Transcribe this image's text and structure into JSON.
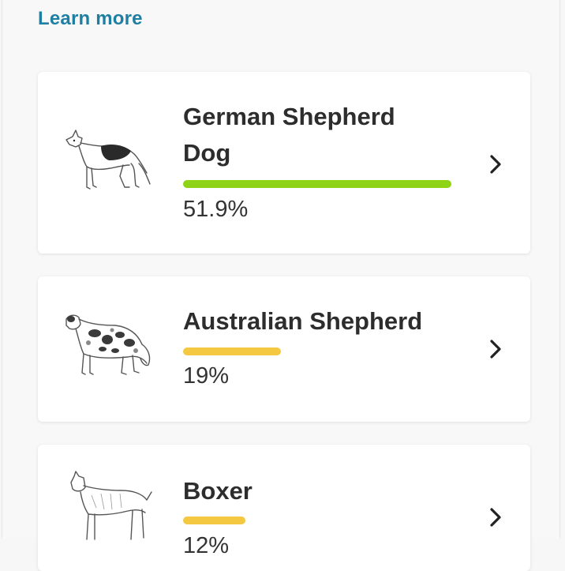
{
  "learn_more": "Learn more",
  "colors": {
    "link": "#1f7fa3",
    "bar_high": "#8fd316",
    "bar_low": "#f5c842"
  },
  "breeds": [
    {
      "name": "German Shepherd Dog",
      "percent_label": "51.9%",
      "percent": 51.9,
      "bar_color": "#8fd316",
      "icon": "german-shepherd-illustration"
    },
    {
      "name": "Australian Shepherd",
      "percent_label": "19%",
      "percent": 19,
      "bar_color": "#f5c842",
      "icon": "australian-shepherd-illustration"
    },
    {
      "name": "Boxer",
      "percent_label": "12%",
      "percent": 12,
      "bar_color": "#f5c842",
      "icon": "boxer-illustration"
    }
  ],
  "chevron_icon": "chevron-right-icon"
}
